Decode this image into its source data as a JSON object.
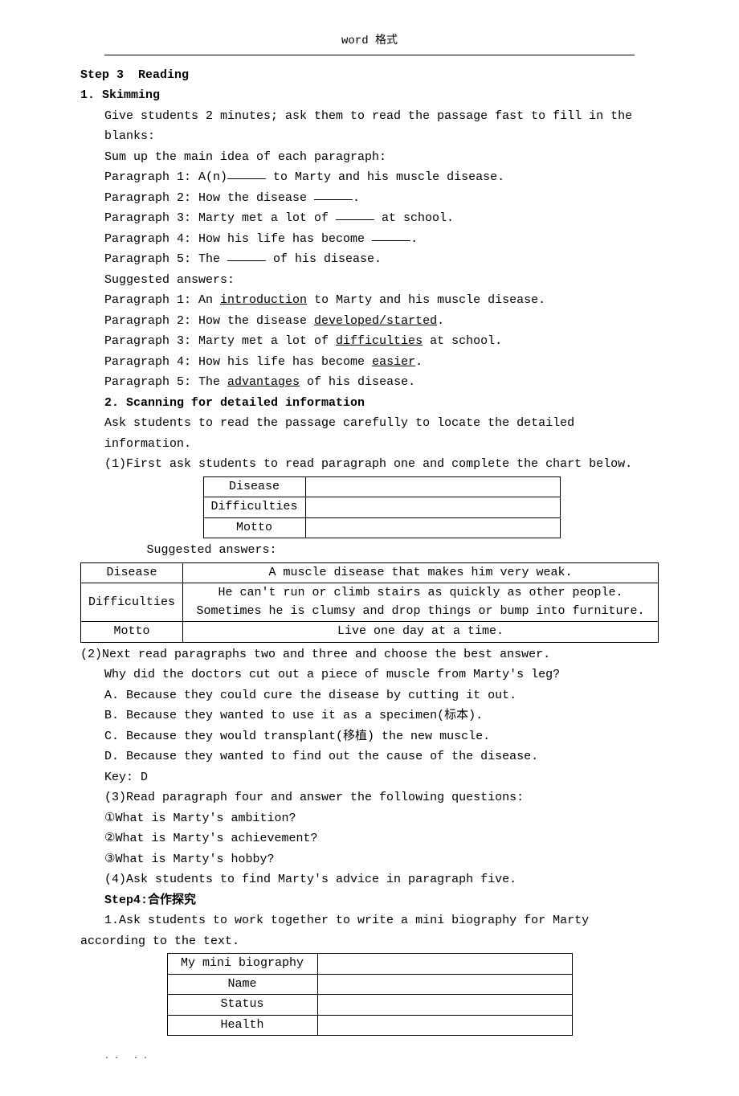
{
  "header": {
    "title": "word 格式"
  },
  "step3": {
    "title": "Step 3  Reading",
    "skimming": {
      "title": "1. Skimming",
      "intro": "Give students 2 minutes; ask them to read the passage fast to fill in the blanks:",
      "sumup": "Sum up the main idea of each paragraph:",
      "p1a": "Paragraph 1: A(n)",
      "p1b": " to Marty and his muscle disease.",
      "p2a": "Paragraph 2: How the disease ",
      "p2b": ".",
      "p3a": "Paragraph 3: Marty met a lot of ",
      "p3b": " at school.",
      "p4a": "Paragraph 4: How his life has become ",
      "p4b": ".",
      "p5a": "Paragraph 5: The ",
      "p5b": " of his disease.",
      "sug": "Suggested answers:",
      "a1a": "Paragraph 1: An ",
      "a1u": "introduction",
      "a1b": " to Marty and his muscle disease.",
      "a2a": "Paragraph 2: How the disease ",
      "a2u": "developed/started",
      "a2b": ".",
      "a3a": "Paragraph 3: Marty met a lot of ",
      "a3u": "difficulties",
      "a3b": " at school.",
      "a4a": "Paragraph 4: How his life has become ",
      "a4u": "easier",
      "a4b": ".",
      "a5a": "Paragraph 5: The ",
      "a5u": "advantages",
      "a5b": " of his disease."
    },
    "scanning": {
      "title": "2. Scanning for detailed information",
      "intro": "Ask students to read the passage carefully to locate the detailed information.",
      "q1": "(1)First ask students to read paragraph one and complete the chart below.",
      "tbl1": {
        "r1": "Disease",
        "r2": "Difficulties",
        "r3": "Motto"
      },
      "sug": "Suggested answers:",
      "tbl2": {
        "r1a": "Disease",
        "r1b": "A muscle disease that makes him very weak.",
        "r2a": "Difficulties",
        "r2b": "He can't run or climb stairs as quickly as other people. Sometimes he is clumsy and drop things or bump into furniture.",
        "r3a": "Motto",
        "r3b": "Live one day at a time."
      },
      "q2": "(2)Next read paragraphs two and three and choose the best answer.",
      "q2q": "Why did the doctors cut out a piece of muscle from Marty's leg?",
      "q2a": "A. Because they could cure the disease by cutting it out.",
      "q2b": "B. Because they wanted to use it as a specimen(标本).",
      "q2c": "C. Because they would transplant(移植) the new muscle.",
      "q2d": "D. Because they wanted to find out the cause of the disease.",
      "key": "Key: D",
      "q3": "(3)Read paragraph four and answer the following questions:",
      "q3a": "①What is Marty's ambition?",
      "q3b": "②What is Marty's achievement?",
      "q3c": "③What is Marty's hobby?",
      "q4": "(4)Ask students to find Marty's advice in paragraph five."
    }
  },
  "step4": {
    "title": "Step4:合作探究",
    "intro": "1.Ask students to work together to write a mini biography for Marty according to the text.",
    "tbl": {
      "r1": "My mini biography",
      "r2": "Name",
      "r3": "Status",
      "r4": "Health"
    }
  },
  "footer": {
    "dots": ".. .."
  }
}
